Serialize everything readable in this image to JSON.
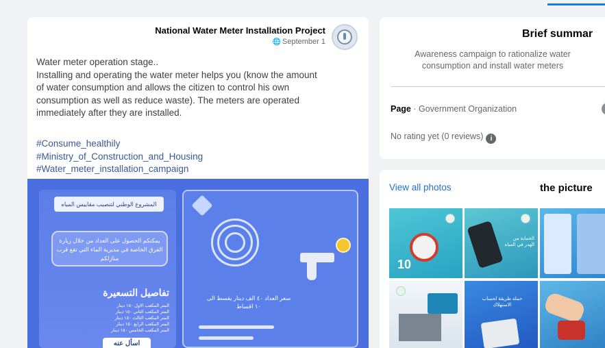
{
  "post": {
    "page_name": "National Water Meter Installation Project",
    "date": "September 1",
    "text_lines": [
      "Water meter operation stage..",
      "Installing and operating the water meter helps you (know the amount",
      "of water consumption and allows the citizen to control his own",
      "consumption as well as reduce waste). The meters are operated",
      "immediately after they are installed."
    ],
    "hashtags": [
      "#Consume_healthily",
      "#Ministry_of_Construction_and_Housing",
      "#Water_meter_installation_campaign"
    ],
    "image": {
      "title_bar": "المشروع الوطني لتنصيب مقاييس المياه",
      "bubble_text": "يمكنكم الحصول على العداد من خلال زيارة الفرق الخاصة في مديرية الماء التي تقع قرب منازلكم",
      "tariff_title": "تفاصيل التسعيرة",
      "tariff_lines": [
        "المتر المكعب الاول ١٥٠ دينار",
        "المتر المكعب الثاني ١٥٠ دينار",
        "المتر المكعب الثالث ١٥٠ دينار",
        "المتر المكعب الرابع ١٥٠ دينار",
        "المتر المكعب الخامس ١٥٠ دينار"
      ],
      "right_text": "سعر العداد ٤٠ الف دينار يقسط الى ١٠ اقساط",
      "bottom_label": "اسأل عنه"
    }
  },
  "summary": {
    "title": "Brief summar",
    "description": "Awareness campaign to rationalize water consumption and install water meters",
    "page_label": "Page",
    "page_category": " · Government Organization",
    "rating_text": "No rating yet (0 reviews)",
    "info_glyph": "i"
  },
  "photos": {
    "view_all": "View all photos",
    "title": "the picture",
    "thumb_labels": [
      "10",
      "الحماية من الهدر في المياه",
      "حملة طريقة لحساب الاستهلاك"
    ]
  },
  "colors": {
    "accent": "#1877f2",
    "link": "#385898",
    "banner": "#4a6fe0"
  }
}
